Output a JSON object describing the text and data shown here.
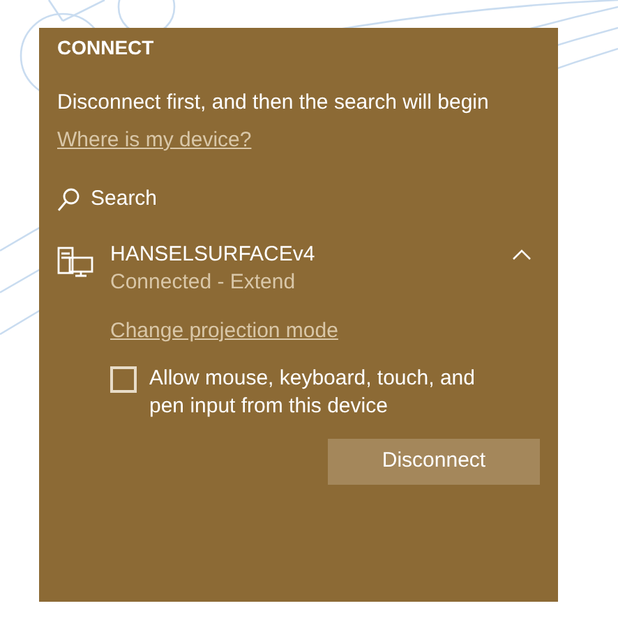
{
  "panel": {
    "title": "CONNECT",
    "message": "Disconnect first, and then the search will begin",
    "help_link": "Where is my device?",
    "search_label": "Search",
    "device": {
      "name": "HANSELSURFACEv4",
      "status": "Connected - Extend",
      "expanded": true
    },
    "projection_link": "Change projection mode",
    "input_checkbox": {
      "label": "Allow mouse, keyboard, touch, and pen input from this device",
      "checked": false
    },
    "disconnect_button": "Disconnect"
  }
}
